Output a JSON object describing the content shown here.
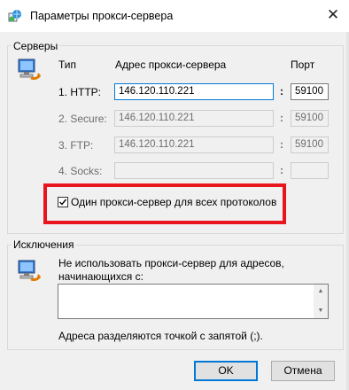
{
  "window": {
    "title": "Параметры прокси-сервера",
    "close_glyph": "✕"
  },
  "servers": {
    "group_label": "Серверы",
    "col_type": "Тип",
    "col_address": "Адрес прокси-сервера",
    "col_port": "Порт",
    "colon": ":",
    "rows": [
      {
        "label": "1. HTTP:",
        "address": "146.120.110.221",
        "port": "59100",
        "enabled": true
      },
      {
        "label": "2. Secure:",
        "address": "146.120.110.221",
        "port": "59100",
        "enabled": false
      },
      {
        "label": "3. FTP:",
        "address": "146.120.110.221",
        "port": "59100",
        "enabled": false
      },
      {
        "label": "4. Socks:",
        "address": "",
        "port": "",
        "enabled": false
      }
    ],
    "same_proxy_label": "Один прокси-сервер для всех протоколов",
    "same_proxy_checked": true,
    "highlight_color": "#e8141e"
  },
  "exceptions": {
    "group_label": "Исключения",
    "description": "Не использовать прокси-сервер для адресов, начинающихся с:",
    "value": "",
    "hint": "Адреса разделяются точкой с запятой (;)."
  },
  "buttons": {
    "ok": "OK",
    "cancel": "Отмена"
  },
  "colors": {
    "focus": "#0078d7"
  }
}
